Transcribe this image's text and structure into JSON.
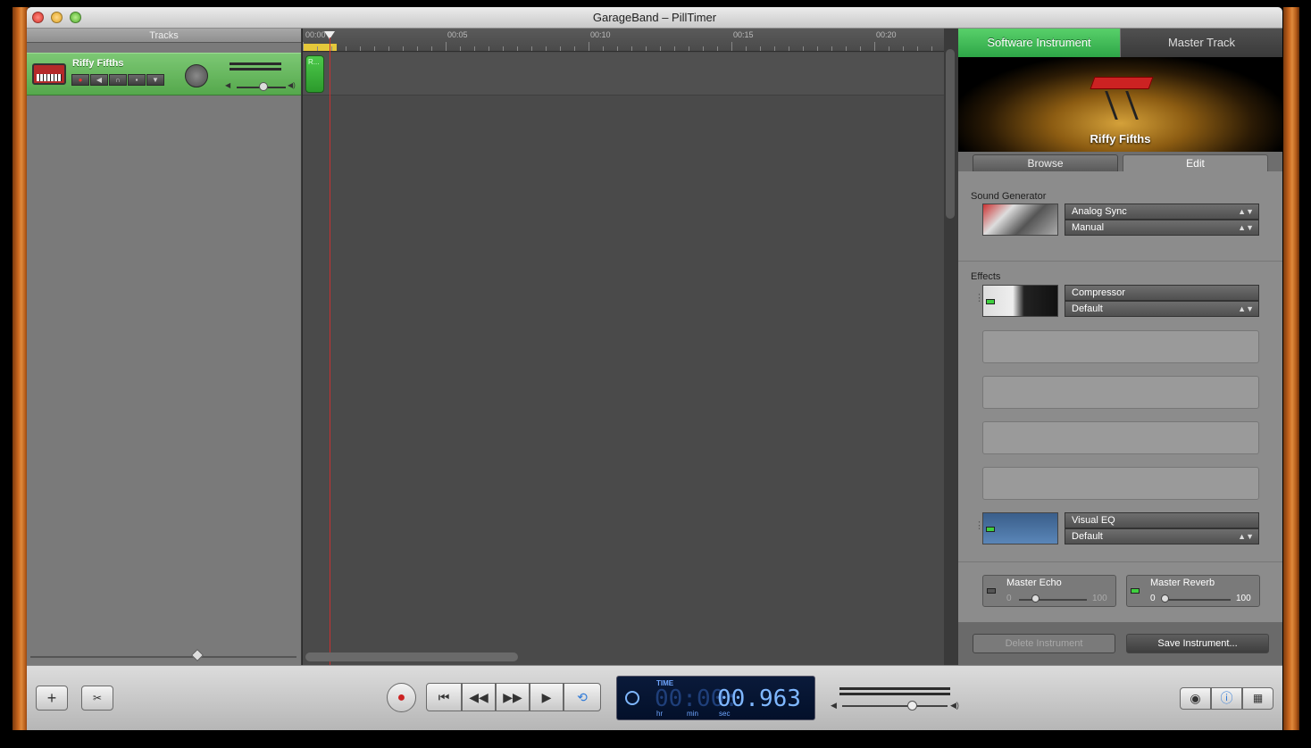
{
  "window": {
    "title": "GarageBand – PillTimer"
  },
  "tracks_header": "Tracks",
  "track": {
    "name": "Riffy Fifths",
    "region_label": "R..."
  },
  "ruler": {
    "labels": [
      "00:00",
      "00:05",
      "00:10",
      "00:15",
      "00:20"
    ]
  },
  "right_tabs": {
    "software": "Software Instrument",
    "master": "Master Track"
  },
  "instrument": {
    "name": "Riffy Fifths"
  },
  "sub_tabs": {
    "browse": "Browse",
    "edit": "Edit"
  },
  "sound_generator": {
    "title": "Sound Generator",
    "generator": "Analog Sync",
    "preset": "Manual"
  },
  "effects": {
    "title": "Effects",
    "compressor": {
      "name": "Compressor",
      "preset": "Default"
    },
    "eq": {
      "name": "Visual EQ",
      "preset": "Default"
    }
  },
  "master_echo": {
    "name": "Master Echo",
    "min": "0",
    "max": "100",
    "level": 0.25,
    "enabled": false
  },
  "master_reverb": {
    "name": "Master Reverb",
    "min": "0",
    "max": "100",
    "level": 0.0,
    "enabled": true
  },
  "buttons": {
    "delete_instrument": "Delete Instrument",
    "save_instrument": "Save Instrument..."
  },
  "lcd": {
    "label": "TIME",
    "dim_digits": "00:00:",
    "value": "00.963",
    "units": [
      "hr",
      "min",
      "sec"
    ]
  },
  "colors": {
    "accent_green": "#2ea647",
    "playhead": "#c93030",
    "lcd_blue": "#7fb7ff"
  }
}
